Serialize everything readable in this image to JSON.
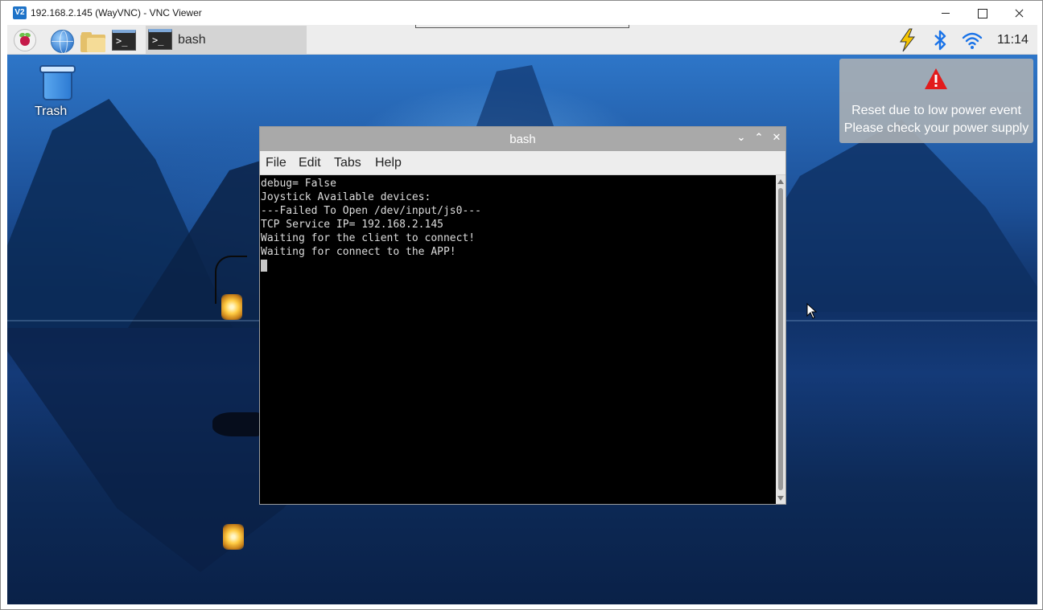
{
  "host": {
    "title": "192.168.2.145 (WayVNC) - VNC Viewer",
    "app_icon": "V2"
  },
  "taskbar": {
    "task_label": "bash",
    "clock": "11:14",
    "launchers": [
      "raspberry-pi-menu-icon",
      "web-browser-icon",
      "file-manager-icon",
      "terminal-icon"
    ],
    "tray": [
      "power-warning-icon",
      "bluetooth-icon",
      "wifi-icon"
    ]
  },
  "desktop": {
    "trash_label": "Trash"
  },
  "notice": {
    "line1": "Reset due to low power event",
    "line2": "Please check your power supply",
    "icon": "warning-triangle-icon"
  },
  "terminal": {
    "title": "bash",
    "menu": {
      "file": "File",
      "edit": "Edit",
      "tabs": "Tabs",
      "help": "Help"
    },
    "lines": [
      "debug= False",
      "Joystick Available devices:",
      "---Failed To Open /dev/input/js0---",
      "TCP Service IP= 192.168.2.145",
      "Waiting for the client to connect!",
      "Waiting for connect to the APP!"
    ]
  },
  "colors": {
    "warning_red": "#e21b1b",
    "power_yellow": "#f5c400",
    "bluetooth_blue": "#1a73e8",
    "wifi_blue": "#1a73e8"
  }
}
